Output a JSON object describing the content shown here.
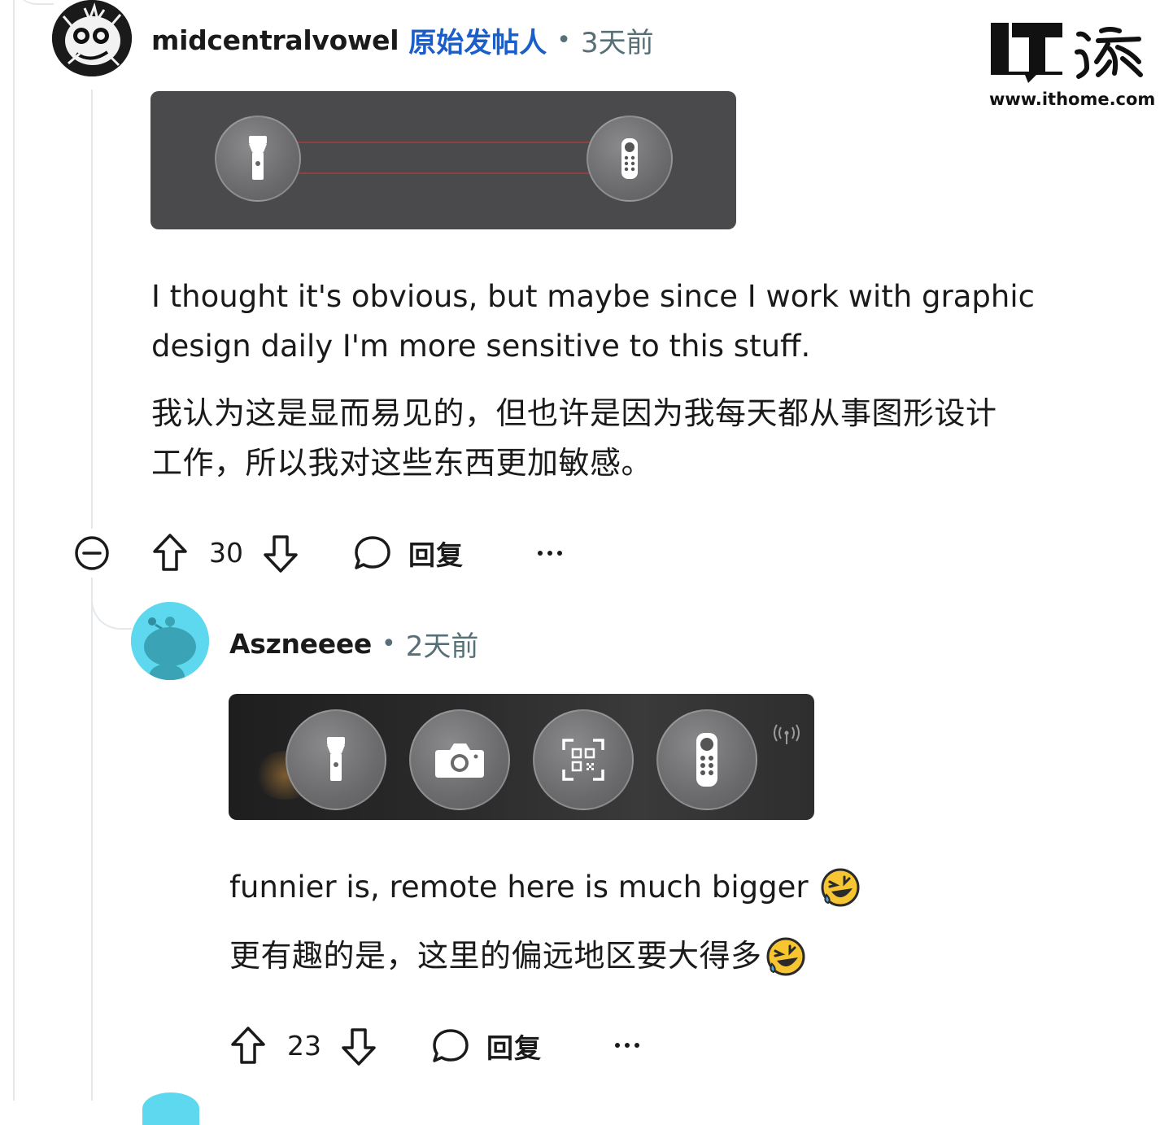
{
  "watermark": {
    "logo_text": "IT之家",
    "url": "www.ithome.com"
  },
  "comment1": {
    "author": "midcentralvowel",
    "op_tag": "原始发帖人",
    "separator": "•",
    "age": "3天前",
    "image_icons": [
      "flashlight-icon",
      "remote-control-icon"
    ],
    "body_en_line1": "I thought it's obvious, but maybe since I work with graphic",
    "body_en_line2": "design daily I'm more sensitive to this stuff.",
    "body_cn_line1": "我认为这是显而易见的，但也许是因为我每天都从事图形设计",
    "body_cn_line2": "工作，所以我对这些东西更加敏感。",
    "votes": "30",
    "reply_label": "回复",
    "more_label": "···"
  },
  "comment2": {
    "author": "Aszneeee",
    "separator": "•",
    "age": "2天前",
    "image_icons": [
      "flashlight-icon",
      "camera-icon",
      "qr-scan-icon",
      "remote-control-icon",
      "wireless-icon"
    ],
    "body_en": "funnier is, remote here is much bigger",
    "body_cn": "更有趣的是，这里的偏远地区要大得多",
    "emoji": "🤣",
    "votes": "23",
    "reply_label": "回复",
    "more_label": "···"
  }
}
